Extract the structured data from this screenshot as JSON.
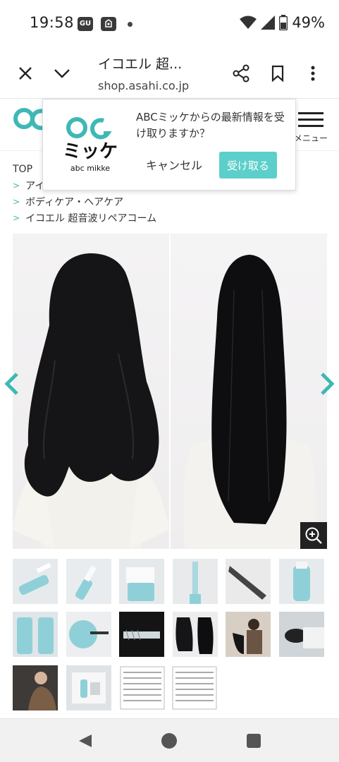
{
  "status_bar": {
    "time": "19:58",
    "app_badge": "GU",
    "battery": "49%",
    "icons": [
      "gu-badge-icon",
      "notification-app-icon",
      "wifi-icon",
      "signal-icon",
      "battery-icon"
    ]
  },
  "browser": {
    "page_title": "イコエル 超...",
    "url": "shop.asahi.co.jp",
    "icons": [
      "close-icon",
      "chevron-down-icon",
      "share-icon",
      "bookmark-icon",
      "more-vert-icon"
    ]
  },
  "site": {
    "logo_text": "abc mikke",
    "menu_label": "メニュー"
  },
  "popup": {
    "logo_katakana": "ミッケ",
    "logo_sub": "abc mikke",
    "message": "ABCミッケからの最新情報を受け取りますか？",
    "cancel_label": "キャンセル",
    "accept_label": "受け取る"
  },
  "breadcrumb": {
    "top": "TOP",
    "items": [
      "アイ",
      "ボディケア・ヘアケア",
      "イコエル 超音波リペアコーム"
    ]
  },
  "gallery": {
    "accent_color": "#3fb8b5",
    "thumbnail_count": 15
  },
  "colors": {
    "brand": "#3fb8b5",
    "accept_button": "#5ccfcb"
  },
  "system_nav": {
    "icons": [
      "back-icon",
      "home-icon",
      "recents-icon"
    ]
  }
}
